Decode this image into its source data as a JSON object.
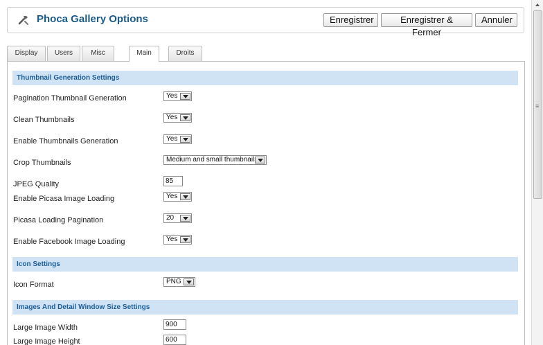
{
  "header": {
    "title": "Phoca Gallery Options",
    "icon": "tools-icon",
    "buttons": {
      "save": "Enregistrer",
      "save_close": "Enregistrer & Fermer",
      "cancel": "Annuler"
    }
  },
  "tabs": [
    {
      "label": "Display"
    },
    {
      "label": "Users"
    },
    {
      "label": "Misc"
    },
    {
      "label": "Main",
      "active": true
    },
    {
      "label": "Droits"
    }
  ],
  "sections": {
    "thumbnail": "Thumbnail Generation Settings",
    "icon": "Icon Settings",
    "images": "Images And Detail Window Size Settings"
  },
  "fields": {
    "pagination_thumb": {
      "label": "Pagination Thumbnail Generation",
      "value": "Yes"
    },
    "clean_thumbs": {
      "label": "Clean Thumbnails",
      "value": "Yes"
    },
    "enable_thumbs": {
      "label": "Enable Thumbnails Generation",
      "value": "Yes"
    },
    "crop_thumbs": {
      "label": "Crop Thumbnails",
      "value": "Medium and small thumbnails"
    },
    "jpeg_quality": {
      "label": "JPEG Quality",
      "value": "85"
    },
    "picasa_loading": {
      "label": "Enable Picasa Image Loading",
      "value": "Yes"
    },
    "picasa_pagination": {
      "label": "Picasa Loading Pagination",
      "value": "20"
    },
    "facebook_loading": {
      "label": "Enable Facebook Image Loading",
      "value": "Yes"
    },
    "icon_format": {
      "label": "Icon Format",
      "value": "PNG"
    },
    "large_width": {
      "label": "Large Image Width",
      "value": "900"
    },
    "large_height": {
      "label": "Large Image Height",
      "value": "600"
    }
  },
  "scrollbar": {
    "grip": "≡"
  },
  "colors": {
    "accent": "#1d5d96",
    "section_bg": "#cfe3f5",
    "title": "#1a5b8a"
  }
}
